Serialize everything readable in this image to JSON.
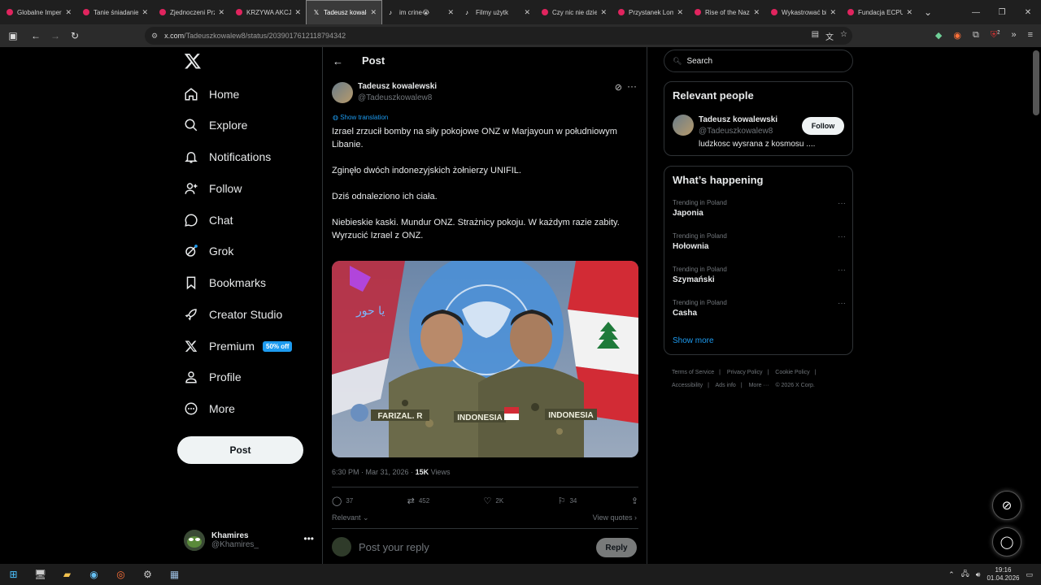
{
  "browser": {
    "tabs": [
      {
        "label": "Globalne Imper",
        "icon": "youtube"
      },
      {
        "label": "Tanie śniadanie",
        "icon": "youtube"
      },
      {
        "label": "Zjednoczeni Prz",
        "icon": "youtube"
      },
      {
        "label": "KRZYWA AKCJA",
        "icon": "youtube"
      },
      {
        "label": "Tadeusz kowalc",
        "icon": "x",
        "active": true
      },
      {
        "label": "im crine😭",
        "icon": "tiktok"
      },
      {
        "label": "Filmy użytk",
        "icon": "tiktok"
      },
      {
        "label": "Czy nic nie dzie",
        "icon": "youtube"
      },
      {
        "label": "Przystanek Lom",
        "icon": "youtube"
      },
      {
        "label": "Rise of the Nazi",
        "icon": "youtube"
      },
      {
        "label": "Wykastrować bi",
        "icon": "youtube"
      },
      {
        "label": "Fundacja ECPU",
        "icon": "youtube"
      }
    ],
    "url_host": "x.com",
    "url_path": "/Tadeuszkowalew8/status/2039017612118794342",
    "ext_badge": "2"
  },
  "nav": {
    "items": [
      {
        "label": "Home",
        "icon": "home-icon"
      },
      {
        "label": "Explore",
        "icon": "search-icon"
      },
      {
        "label": "Notifications",
        "icon": "bell-icon"
      },
      {
        "label": "Follow",
        "icon": "person-add-icon"
      },
      {
        "label": "Chat",
        "icon": "chat-icon"
      },
      {
        "label": "Grok",
        "icon": "grok-icon"
      },
      {
        "label": "Bookmarks",
        "icon": "bookmark-icon"
      },
      {
        "label": "Creator Studio",
        "icon": "rocket-icon"
      },
      {
        "label": "Premium",
        "icon": "x-icon"
      },
      {
        "label": "Profile",
        "icon": "person-icon"
      },
      {
        "label": "More",
        "icon": "more-circle-icon"
      }
    ],
    "premium_badge": "50% off",
    "post_button": "Post",
    "account": {
      "name": "Khamires",
      "handle": "@Khamires_"
    }
  },
  "post": {
    "header_title": "Post",
    "author_name": "Tadeusz kowalewski",
    "author_handle": "@Tadeuszkowalew8",
    "show_translation": "Show translation",
    "lines": [
      "Izrael zrzucił bomby na siły pokojowe ONZ w Marjayoun w południowym Libanie.",
      "",
      "Zginęło dwóch indonezyjskich żołnierzy UNIFIL.",
      "",
      "Dziś odnaleziono ich ciała.",
      "",
      "Niebieskie kaski.  Mundur ONZ.  Strażnicy pokoju.  W każdym razie zabity.",
      "Wyrzucić Izrael z ONZ."
    ],
    "image_patches": [
      "FARIZAL. R",
      "INDONESIA",
      "INDONESIA"
    ],
    "image_watermark": "یا حور",
    "timestamp": "6:30 PM · Mar 31, 2026",
    "views_count": "15K",
    "views_label": "Views",
    "replies": "37",
    "reposts": "452",
    "likes": "2K",
    "bookmarks": "34",
    "relevant_label": "Relevant",
    "view_quotes": "View quotes",
    "reply_placeholder": "Post your reply",
    "reply_button": "Reply"
  },
  "right": {
    "search_placeholder": "Search",
    "relevant_people_title": "Relevant people",
    "person": {
      "name": "Tadeusz kowalewski",
      "handle": "@Tadeuszkowalew8",
      "bio": "ludzkosc wysrana z kosmosu ....",
      "follow": "Follow"
    },
    "happening_title": "What’s happening",
    "trends": [
      {
        "context": "Trending in Poland",
        "name": "Japonia"
      },
      {
        "context": "Trending in Poland",
        "name": "Hołownia"
      },
      {
        "context": "Trending in Poland",
        "name": "Szymański"
      },
      {
        "context": "Trending in Poland",
        "name": "Casha"
      }
    ],
    "show_more": "Show more",
    "footer": [
      "Terms of Service",
      "|",
      "Privacy Policy",
      "|",
      "Cookie Policy",
      "|",
      "Accessibility",
      "|",
      "Ads info",
      "|",
      "More ···",
      "© 2026 X Corp."
    ]
  },
  "taskbar": {
    "time": "19:16",
    "date": "01.04.2026"
  },
  "colors": {
    "accent": "#1d9bf0",
    "background": "#000000",
    "border": "#2f3336",
    "muted": "#71767b"
  }
}
